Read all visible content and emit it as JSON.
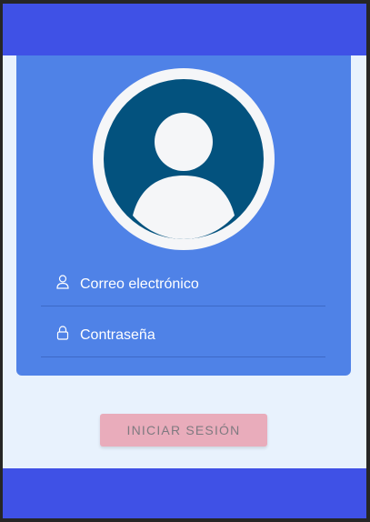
{
  "form": {
    "email_label": "Correo electrónico",
    "password_label": "Contraseña",
    "email_icon": "user-icon",
    "password_icon": "lock-icon"
  },
  "actions": {
    "login_label": "INICIAR SESIÓN"
  },
  "colors": {
    "header": "#3f51e6",
    "card": "#4f82e7",
    "avatar_bg": "#03527e",
    "button": "#e9acbb",
    "page_bg": "#e8f2fd"
  }
}
